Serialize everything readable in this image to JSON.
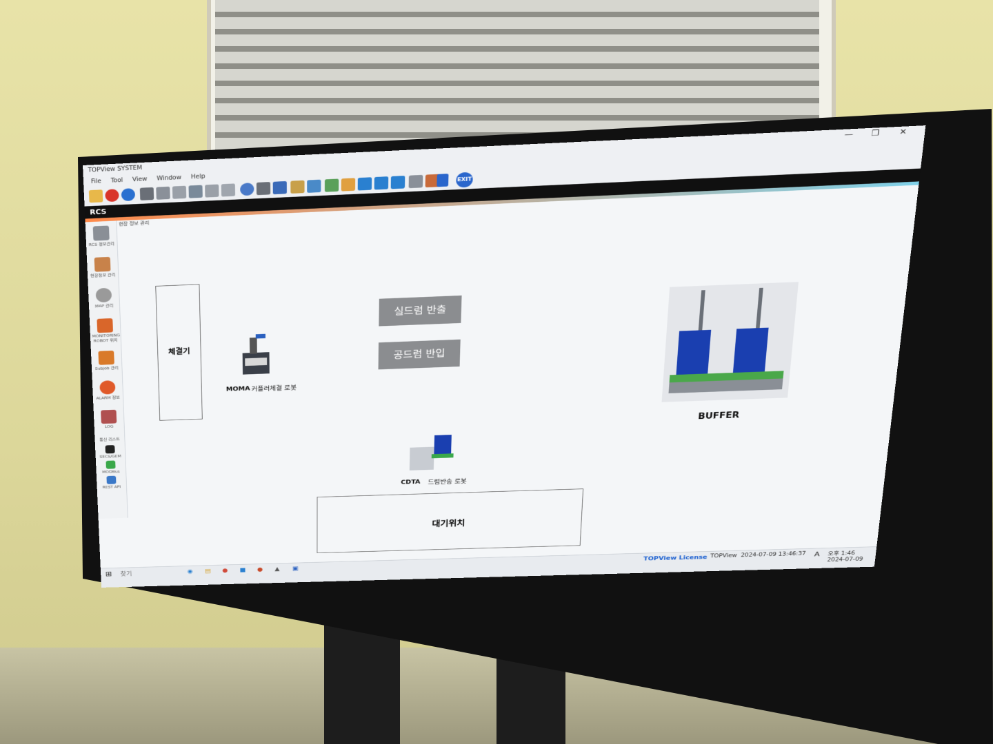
{
  "window": {
    "title": "TOPView SYSTEM",
    "minimize_icon": "—",
    "restore_icon": "❐",
    "close_icon": "✕"
  },
  "menu": {
    "items": [
      "File",
      "Tool",
      "View",
      "Window",
      "Help"
    ]
  },
  "toolbar": {
    "exit_label": "EXIT"
  },
  "header": {
    "title": "RCS"
  },
  "tab": {
    "label": "현장 정보 관리"
  },
  "sidebar": {
    "items": [
      {
        "label": "RCS 정보관리",
        "color": "#8a8f96"
      },
      {
        "label": "현장정보 관리",
        "color": "#c8824a"
      },
      {
        "label": "MAP 관리",
        "color": "#9a9a9a"
      },
      {
        "label": "MONITORING ROBOT 위치",
        "color": "#d9662a"
      },
      {
        "label": "Subjob 관리",
        "color": "#d97a2a"
      },
      {
        "label": "ALARM 정보",
        "color": "#e05a2a"
      },
      {
        "label": "LOG",
        "color": "#b05050"
      }
    ],
    "comm_title": "통신 리스트",
    "comm_items": [
      {
        "label": "SECS/GEM",
        "color": "#222222"
      },
      {
        "label": "MODBus",
        "color": "#3aa84a"
      },
      {
        "label": "REST API",
        "color": "#3a78c8"
      }
    ]
  },
  "main": {
    "fastener_box_label": "체결기",
    "moma": {
      "code": "MOMA",
      "desc": "커플러체결 로봇"
    },
    "btn_full_drum_out": "실드럼 반출",
    "btn_empty_drum_in": "공드럼 반입",
    "buffer_label": "BUFFER",
    "cdta": {
      "code": "CDTA",
      "desc": "드럼반송 로봇"
    },
    "standby_label": "대기위치"
  },
  "taskbar": {
    "search_placeholder": "찾기",
    "license_label": "TOPView License",
    "status_app": "TOPView",
    "status_timestamp": "2024-07-09 13:46:37",
    "clock_time": "오후 1:46",
    "clock_date": "2024-07-09",
    "ime_indicator": "A"
  }
}
